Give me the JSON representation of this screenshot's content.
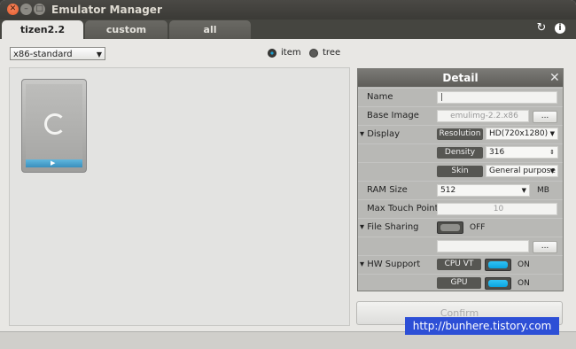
{
  "window": {
    "title": "Emulator Manager"
  },
  "tabs": [
    {
      "label": "tizen2.2",
      "active": true
    },
    {
      "label": "custom",
      "active": false
    },
    {
      "label": "all",
      "active": false
    }
  ],
  "toolbar": {
    "refresh_icon": "refresh-icon",
    "info_icon": "info-icon"
  },
  "filter": {
    "profile": "x86-standard"
  },
  "view_mode": {
    "item_label": "item",
    "tree_label": "tree",
    "selected": "item"
  },
  "detail": {
    "title": "Detail",
    "name_label": "Name",
    "name_value": "|",
    "base_image_label": "Base Image",
    "base_image_value": "emulimg-2.2.x86",
    "browse_label": "...",
    "display_label": "Display",
    "resolution_label": "Resolution",
    "resolution_value": "HD(720x1280)",
    "density_label": "Density",
    "density_value": "316",
    "skin_label": "Skin",
    "skin_value": "General purpose",
    "ram_label": "RAM Size",
    "ram_value": "512",
    "ram_unit": "MB",
    "touch_label": "Max Touch Point",
    "touch_value": "10",
    "file_sharing_label": "File Sharing",
    "file_sharing_state": "OFF",
    "file_sharing_browse": "...",
    "hw_label": "HW Support",
    "cpu_label": "CPU VT",
    "cpu_state": "ON",
    "gpu_label": "GPU",
    "gpu_state": "ON"
  },
  "confirm_label": "Confirm",
  "watermark": "http://bunhere.tistory.com",
  "colors": {
    "accent": "#1ea8e0",
    "titlebar": "#3b3a36",
    "close": "#e35b2c"
  }
}
